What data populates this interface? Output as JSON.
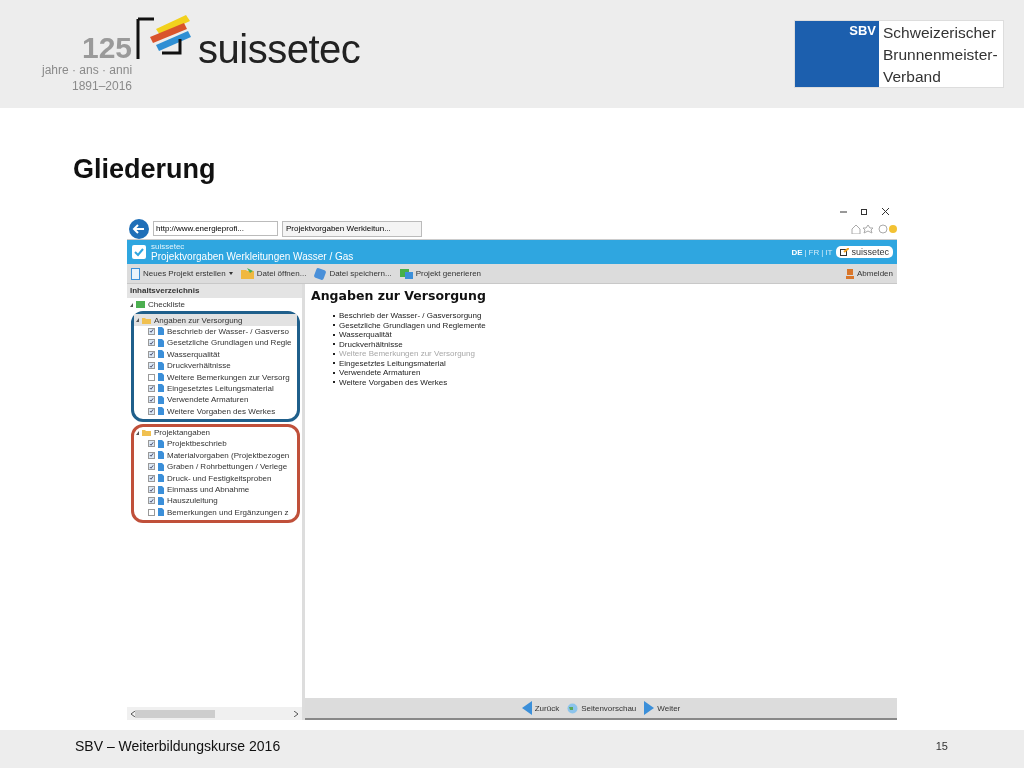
{
  "header": {
    "anniversary": {
      "number": "125",
      "tagline": "jahre · ans · anni",
      "years": "1891–2016"
    },
    "brand": "suissetec",
    "partner": {
      "short": "SBV",
      "lines": [
        "Schweizerischer",
        "Brunnenmeister-",
        "Verband"
      ]
    }
  },
  "title": "Gliederung",
  "browser": {
    "address": "http://www.energieprofi...",
    "tab": "Projektvorgaben Werkleitun...",
    "app": {
      "brand": "suissetec",
      "title": "Projektvorgaben Werkleitungen Wasser / Gas",
      "languages": [
        {
          "label": "DE",
          "selected": true
        },
        {
          "label": "FR",
          "selected": false
        },
        {
          "label": "IT",
          "selected": false
        }
      ],
      "separator": "|",
      "logo": "suissetec"
    },
    "toolbar": [
      {
        "label": "Neues Projekt erstellen",
        "kind": "new",
        "dropdown": true
      },
      {
        "label": "Datei öffnen...",
        "kind": "open",
        "dropdown": false
      },
      {
        "label": "Datei speichern...",
        "kind": "save",
        "dropdown": false
      },
      {
        "label": "Projekt generieren",
        "kind": "generate",
        "dropdown": false
      }
    ],
    "logout": "Abmelden",
    "sidebar": {
      "header": "Inhaltsverzeichnis",
      "root": "Checkliste",
      "groups": [
        {
          "label": "Angaben zur Versorgung",
          "color": "#1f5f8b",
          "selected": true,
          "children": [
            {
              "label": "Beschrieb der Wasser- / Gasverso",
              "checked": true
            },
            {
              "label": "Gesetzliche Grundlagen und Regle",
              "checked": true
            },
            {
              "label": "Wasserqualität",
              "checked": true
            },
            {
              "label": "Druckverhältnisse",
              "checked": true
            },
            {
              "label": "Weitere Bemerkungen zur Versorg",
              "checked": false
            },
            {
              "label": "Eingesetztes Leitungsmaterial",
              "checked": true
            },
            {
              "label": "Verwendete Armaturen",
              "checked": true
            },
            {
              "label": "Weitere Vorgaben des Werkes",
              "checked": true
            }
          ]
        },
        {
          "label": "Projektangaben",
          "color": "#c0503a",
          "selected": false,
          "children": [
            {
              "label": "Projektbeschrieb",
              "checked": true
            },
            {
              "label": "Materialvorgaben (Projektbezogen",
              "checked": true
            },
            {
              "label": "Graben / Rohrbettungen / Verlege",
              "checked": true
            },
            {
              "label": "Druck- und Festigkeitsproben",
              "checked": true
            },
            {
              "label": "Einmass und Abnahme",
              "checked": true
            },
            {
              "label": "Hauszuleitung",
              "checked": true
            },
            {
              "label": "Bemerkungen und Ergänzungen z",
              "checked": false
            }
          ]
        }
      ]
    },
    "content": {
      "heading": "Angaben zur Versorgung",
      "items": [
        {
          "label": "Beschrieb der Wasser- / Gasversorgung",
          "disabled": false
        },
        {
          "label": "Gesetzliche Grundlagen und Reglemente",
          "disabled": false
        },
        {
          "label": "Wasserqualität",
          "disabled": false
        },
        {
          "label": "Druckverhältnisse",
          "disabled": false
        },
        {
          "label": "Weitere Bemerkungen zur Versorgung",
          "disabled": true
        },
        {
          "label": "Eingesetztes Leitungsmaterial",
          "disabled": false
        },
        {
          "label": "Verwendete Armaturen",
          "disabled": false
        },
        {
          "label": "Weitere Vorgaben des Werkes",
          "disabled": false
        }
      ]
    },
    "nav": [
      {
        "label": "Zurück",
        "kind": "back"
      },
      {
        "label": "Seitenvorschau",
        "kind": "preview"
      },
      {
        "label": "Weiter",
        "kind": "next"
      }
    ]
  },
  "footer": {
    "text": "SBV – Weiterbildungskurse 2016",
    "page": "15"
  }
}
